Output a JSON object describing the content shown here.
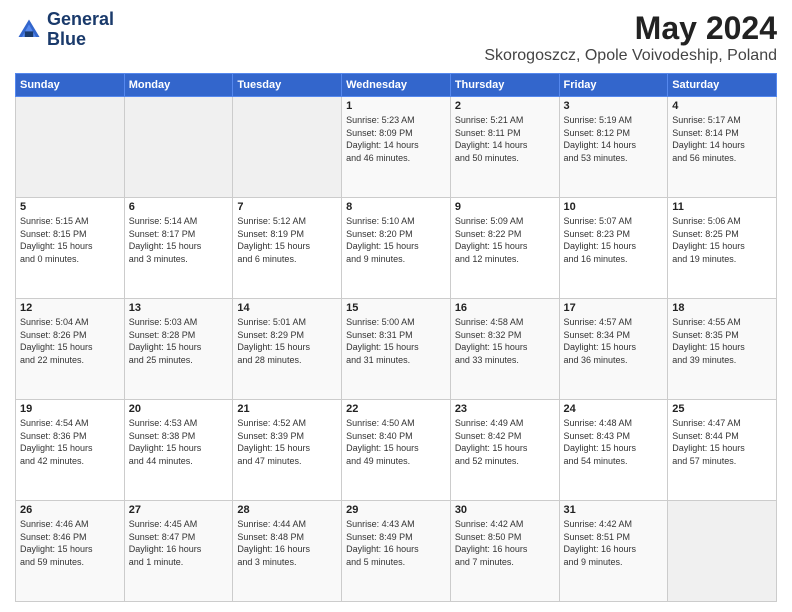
{
  "header": {
    "logo_line1": "General",
    "logo_line2": "Blue",
    "title": "May 2024",
    "subtitle": "Skorogoszcz, Opole Voivodeship, Poland"
  },
  "weekdays": [
    "Sunday",
    "Monday",
    "Tuesday",
    "Wednesday",
    "Thursday",
    "Friday",
    "Saturday"
  ],
  "weeks": [
    [
      {
        "day": "",
        "info": ""
      },
      {
        "day": "",
        "info": ""
      },
      {
        "day": "",
        "info": ""
      },
      {
        "day": "1",
        "info": "Sunrise: 5:23 AM\nSunset: 8:09 PM\nDaylight: 14 hours\nand 46 minutes."
      },
      {
        "day": "2",
        "info": "Sunrise: 5:21 AM\nSunset: 8:11 PM\nDaylight: 14 hours\nand 50 minutes."
      },
      {
        "day": "3",
        "info": "Sunrise: 5:19 AM\nSunset: 8:12 PM\nDaylight: 14 hours\nand 53 minutes."
      },
      {
        "day": "4",
        "info": "Sunrise: 5:17 AM\nSunset: 8:14 PM\nDaylight: 14 hours\nand 56 minutes."
      }
    ],
    [
      {
        "day": "5",
        "info": "Sunrise: 5:15 AM\nSunset: 8:15 PM\nDaylight: 15 hours\nand 0 minutes."
      },
      {
        "day": "6",
        "info": "Sunrise: 5:14 AM\nSunset: 8:17 PM\nDaylight: 15 hours\nand 3 minutes."
      },
      {
        "day": "7",
        "info": "Sunrise: 5:12 AM\nSunset: 8:19 PM\nDaylight: 15 hours\nand 6 minutes."
      },
      {
        "day": "8",
        "info": "Sunrise: 5:10 AM\nSunset: 8:20 PM\nDaylight: 15 hours\nand 9 minutes."
      },
      {
        "day": "9",
        "info": "Sunrise: 5:09 AM\nSunset: 8:22 PM\nDaylight: 15 hours\nand 12 minutes."
      },
      {
        "day": "10",
        "info": "Sunrise: 5:07 AM\nSunset: 8:23 PM\nDaylight: 15 hours\nand 16 minutes."
      },
      {
        "day": "11",
        "info": "Sunrise: 5:06 AM\nSunset: 8:25 PM\nDaylight: 15 hours\nand 19 minutes."
      }
    ],
    [
      {
        "day": "12",
        "info": "Sunrise: 5:04 AM\nSunset: 8:26 PM\nDaylight: 15 hours\nand 22 minutes."
      },
      {
        "day": "13",
        "info": "Sunrise: 5:03 AM\nSunset: 8:28 PM\nDaylight: 15 hours\nand 25 minutes."
      },
      {
        "day": "14",
        "info": "Sunrise: 5:01 AM\nSunset: 8:29 PM\nDaylight: 15 hours\nand 28 minutes."
      },
      {
        "day": "15",
        "info": "Sunrise: 5:00 AM\nSunset: 8:31 PM\nDaylight: 15 hours\nand 31 minutes."
      },
      {
        "day": "16",
        "info": "Sunrise: 4:58 AM\nSunset: 8:32 PM\nDaylight: 15 hours\nand 33 minutes."
      },
      {
        "day": "17",
        "info": "Sunrise: 4:57 AM\nSunset: 8:34 PM\nDaylight: 15 hours\nand 36 minutes."
      },
      {
        "day": "18",
        "info": "Sunrise: 4:55 AM\nSunset: 8:35 PM\nDaylight: 15 hours\nand 39 minutes."
      }
    ],
    [
      {
        "day": "19",
        "info": "Sunrise: 4:54 AM\nSunset: 8:36 PM\nDaylight: 15 hours\nand 42 minutes."
      },
      {
        "day": "20",
        "info": "Sunrise: 4:53 AM\nSunset: 8:38 PM\nDaylight: 15 hours\nand 44 minutes."
      },
      {
        "day": "21",
        "info": "Sunrise: 4:52 AM\nSunset: 8:39 PM\nDaylight: 15 hours\nand 47 minutes."
      },
      {
        "day": "22",
        "info": "Sunrise: 4:50 AM\nSunset: 8:40 PM\nDaylight: 15 hours\nand 49 minutes."
      },
      {
        "day": "23",
        "info": "Sunrise: 4:49 AM\nSunset: 8:42 PM\nDaylight: 15 hours\nand 52 minutes."
      },
      {
        "day": "24",
        "info": "Sunrise: 4:48 AM\nSunset: 8:43 PM\nDaylight: 15 hours\nand 54 minutes."
      },
      {
        "day": "25",
        "info": "Sunrise: 4:47 AM\nSunset: 8:44 PM\nDaylight: 15 hours\nand 57 minutes."
      }
    ],
    [
      {
        "day": "26",
        "info": "Sunrise: 4:46 AM\nSunset: 8:46 PM\nDaylight: 15 hours\nand 59 minutes."
      },
      {
        "day": "27",
        "info": "Sunrise: 4:45 AM\nSunset: 8:47 PM\nDaylight: 16 hours\nand 1 minute."
      },
      {
        "day": "28",
        "info": "Sunrise: 4:44 AM\nSunset: 8:48 PM\nDaylight: 16 hours\nand 3 minutes."
      },
      {
        "day": "29",
        "info": "Sunrise: 4:43 AM\nSunset: 8:49 PM\nDaylight: 16 hours\nand 5 minutes."
      },
      {
        "day": "30",
        "info": "Sunrise: 4:42 AM\nSunset: 8:50 PM\nDaylight: 16 hours\nand 7 minutes."
      },
      {
        "day": "31",
        "info": "Sunrise: 4:42 AM\nSunset: 8:51 PM\nDaylight: 16 hours\nand 9 minutes."
      },
      {
        "day": "",
        "info": ""
      }
    ]
  ]
}
